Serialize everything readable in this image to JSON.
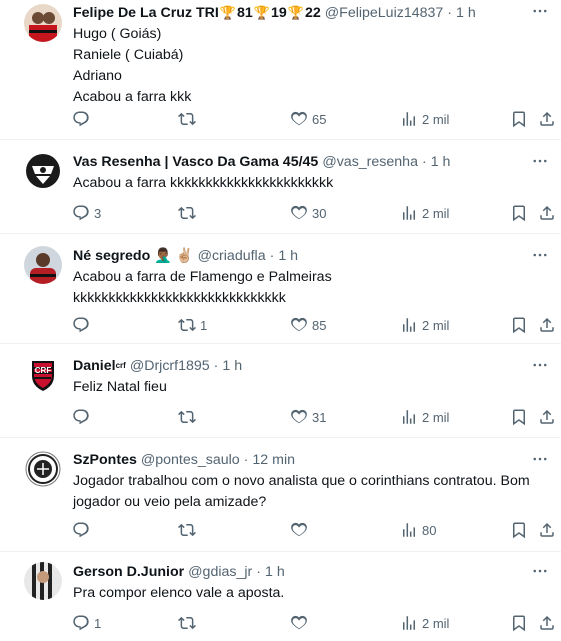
{
  "tweets": [
    {
      "author": "Felipe De La Cruz TRI",
      "name_suffix": "81",
      "name_suffix2": "19",
      "name_suffix3": "22",
      "handle": "@FelipeLuiz14837",
      "time": "1 h",
      "lines": [
        "Hugo ( Goiás)",
        "Raniele ( Cuiabá)",
        "Adriano",
        "Acabou a farra kkk"
      ],
      "replies": "",
      "retweets": "",
      "likes": "65",
      "views": "2 mil",
      "avatar_color": "#c4161c"
    },
    {
      "author": "Vas Resenha | Vasco Da Gama 45/45",
      "handle": "@vas_resenha",
      "time": "1 h",
      "lines": [
        "Acabou a farra kkkkkkkkkkkkkkkkkkkkkkk"
      ],
      "replies": "3",
      "retweets": "",
      "likes": "30",
      "views": "2 mil",
      "avatar_color": "#222222"
    },
    {
      "author": "Né segredo",
      "name_emoji": "🤦🏾‍♂️ ✌🏼",
      "handle": "@criadufla",
      "time": "1 h",
      "lines": [
        "Acabou a farra de Flamengo e Palmeiras",
        "kkkkkkkkkkkkkkkkkkkkkkkkkkkkkk"
      ],
      "replies": "",
      "retweets": "1",
      "likes": "85",
      "views": "2 mil",
      "avatar_color": "#b51e24"
    },
    {
      "author": "Daniel",
      "name_sup": "crf",
      "handle": "@Drjcrf1895",
      "time": "1 h",
      "lines": [
        "Feliz Natal fieu"
      ],
      "replies": "",
      "retweets": "",
      "likes": "31",
      "views": "2 mil",
      "avatar_color": "#c8102e"
    },
    {
      "author": "SzPontes",
      "handle": "@pontes_saulo",
      "time": "12 min",
      "lines": [
        "Jogador trabalhou com o novo analista que o corinthians contratou. Bom",
        "jogador ou veio pela amizade?"
      ],
      "replies": "",
      "retweets": "",
      "likes": "",
      "views": "80",
      "avatar_color": "#ffffff"
    },
    {
      "author": "Gerson D.Junior",
      "handle": "@gdias_jr",
      "time": "1 h",
      "lines": [
        "Pra compor elenco vale a aposta."
      ],
      "replies": "1",
      "retweets": "",
      "likes": "",
      "views": "2 mil",
      "avatar_color": "#333333"
    }
  ],
  "icons": {
    "reply": "reply-icon",
    "retweet": "retweet-icon",
    "like": "like-icon",
    "views": "views-icon",
    "bookmark": "bookmark-icon",
    "share": "share-icon",
    "more": "more-icon"
  },
  "colors": {
    "text": "#0f1419",
    "secondary": "#536471",
    "divider": "#eff3f4"
  }
}
